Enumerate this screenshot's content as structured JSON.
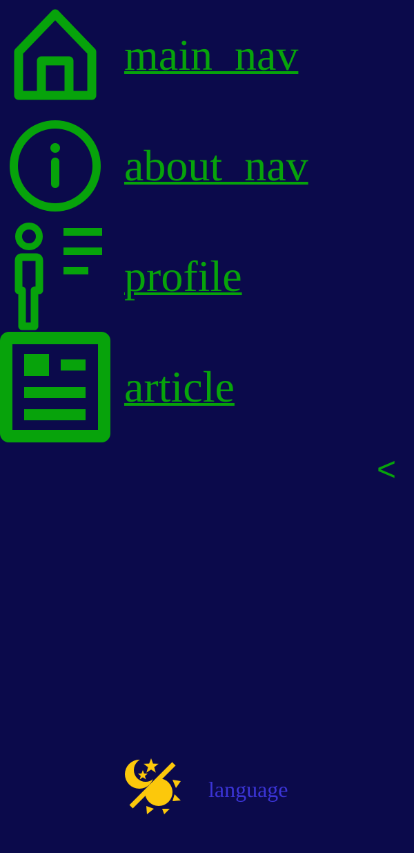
{
  "nav": {
    "items": [
      {
        "label": "main  nav",
        "icon": "home-icon"
      },
      {
        "label": "about  nav",
        "icon": "info-icon"
      },
      {
        "label": "profile",
        "icon": "profile-icon"
      },
      {
        "label": "article",
        "icon": "article-icon"
      }
    ],
    "collapse_label": "<"
  },
  "footer": {
    "theme_icon": "day-night-toggle-icon",
    "language_label": "language"
  },
  "colors": {
    "background": "#0b0a4b",
    "nav_accent": "#07a30b",
    "theme_icon": "#fcc80b",
    "language_link": "#3b34d6"
  }
}
